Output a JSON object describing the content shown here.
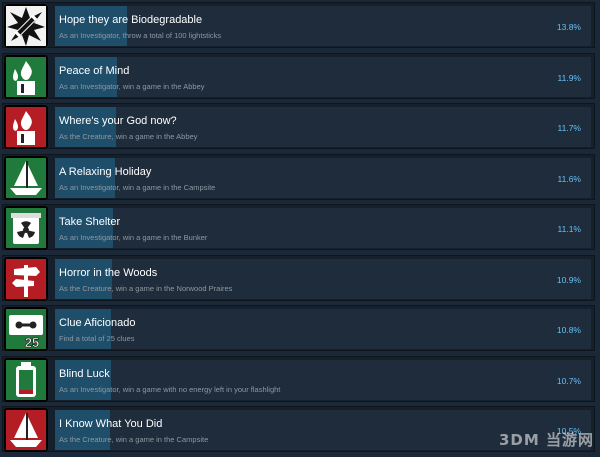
{
  "achievements": [
    {
      "title": "Hope they are Biodegradable",
      "description": "As an Investigator, throw a total of 100 lightsticks",
      "percent": "13.8%",
      "progress": 0.138,
      "icon": "lightstick-burst-icon",
      "icon_bg": "#f2f2f2",
      "icon_fg": "#111111",
      "icon_badge": ""
    },
    {
      "title": "Peace of Mind",
      "description": "As an Investigator, win a game in the Abbey",
      "percent": "11.9%",
      "progress": 0.119,
      "icon": "candle-flame-icon",
      "icon_bg": "#1f7a3c",
      "icon_fg": "#ffffff",
      "icon_badge": ""
    },
    {
      "title": "Where's your God now?",
      "description": "As the Creature, win a game in the Abbey",
      "percent": "11.7%",
      "progress": 0.117,
      "icon": "candle-flame-icon",
      "icon_bg": "#b51d24",
      "icon_fg": "#ffffff",
      "icon_badge": ""
    },
    {
      "title": "A Relaxing Holiday",
      "description": "As an Investigator, win a game in the Campsite",
      "percent": "11.6%",
      "progress": 0.116,
      "icon": "sailboat-icon",
      "icon_bg": "#1f7a3c",
      "icon_fg": "#ffffff",
      "icon_badge": ""
    },
    {
      "title": "Take Shelter",
      "description": "As an Investigator, win a game in the Bunker",
      "percent": "11.1%",
      "progress": 0.111,
      "icon": "radiation-barrel-icon",
      "icon_bg": "#1f7a3c",
      "icon_fg": "#ffffff",
      "icon_badge": ""
    },
    {
      "title": "Horror in the Woods",
      "description": "As the Creature, win a game in the Norwood Praires",
      "percent": "10.9%",
      "progress": 0.109,
      "icon": "signpost-icon",
      "icon_bg": "#b51d24",
      "icon_fg": "#ffffff",
      "icon_badge": ""
    },
    {
      "title": "Clue Aficionado",
      "description": "Find a total of 25 clues",
      "percent": "10.8%",
      "progress": 0.108,
      "icon": "cassette-tape-icon",
      "icon_bg": "#1f7a3c",
      "icon_fg": "#ffffff",
      "icon_badge": "25"
    },
    {
      "title": "Blind Luck",
      "description": "As an Investigator, win a game with no energy left in your flashlight",
      "percent": "10.7%",
      "progress": 0.107,
      "icon": "empty-battery-icon",
      "icon_bg": "#1f7a3c",
      "icon_fg": "#ffffff",
      "icon_badge": ""
    },
    {
      "title": "I Know What You Did",
      "description": "As the Creature, win a game in the Campsite",
      "percent": "10.5%",
      "progress": 0.105,
      "icon": "sailboat-icon",
      "icon_bg": "#b51d24",
      "icon_fg": "#ffffff",
      "icon_badge": ""
    }
  ],
  "watermark": "3DM 当游网",
  "colors": {
    "page_bg": "#1b2838",
    "row_bg": "#1e2c3b",
    "progress_fill": "#1f4e6b",
    "title": "#ffffff",
    "description": "#8f98a0",
    "percent": "#66c0f4"
  }
}
